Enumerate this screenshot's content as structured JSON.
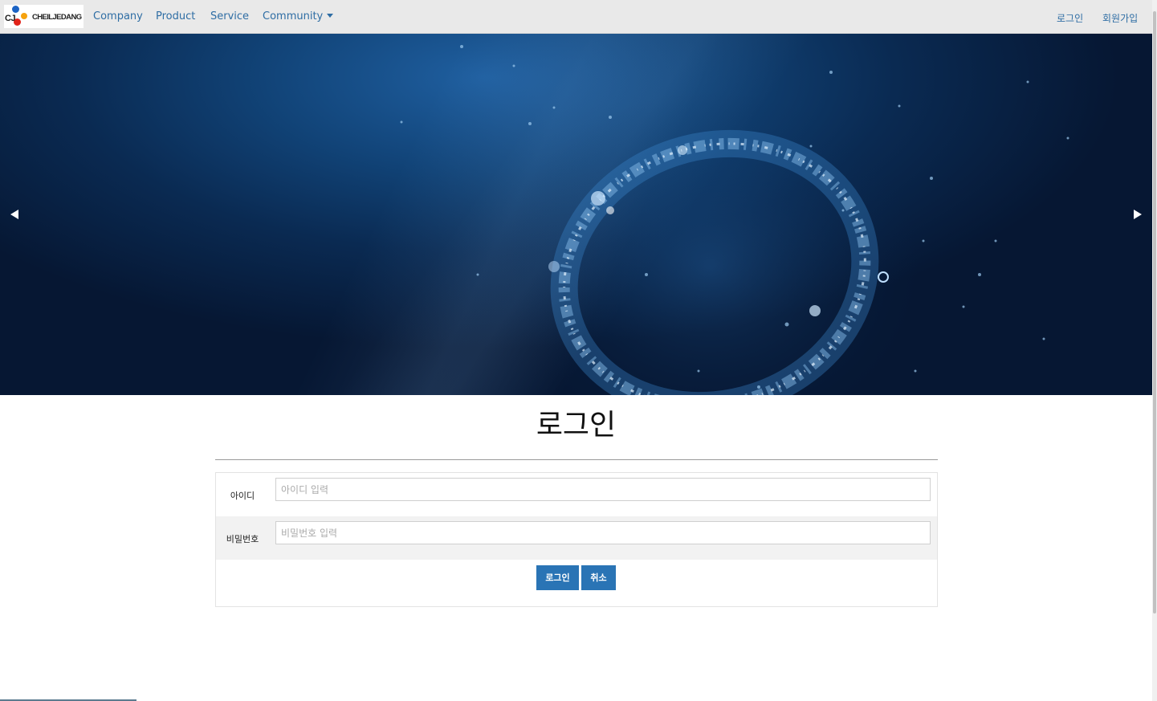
{
  "navbar": {
    "logo": {
      "mark": "CJ",
      "text": "CHEILJEDANG",
      "colors": {
        "blue": "#1b63c4",
        "red": "#e2231a",
        "orange": "#f6a20e"
      }
    },
    "links": [
      "Company",
      "Product",
      "Service",
      "Community"
    ],
    "right_links": [
      "로그인",
      "회원가입"
    ],
    "link_color": "#2e6da4"
  },
  "carousel": {
    "prev_icon": "triangle-left-icon",
    "next_icon": "triangle-right-icon"
  },
  "login": {
    "title": "로그인",
    "fields": [
      {
        "label": "아이디",
        "placeholder": "아이디 입력",
        "value": ""
      },
      {
        "label": "비밀번호",
        "placeholder": "비밀번호 입력",
        "value": ""
      }
    ],
    "buttons": {
      "submit": "로그인",
      "cancel": "취소"
    },
    "button_color": "#2a74b5"
  }
}
